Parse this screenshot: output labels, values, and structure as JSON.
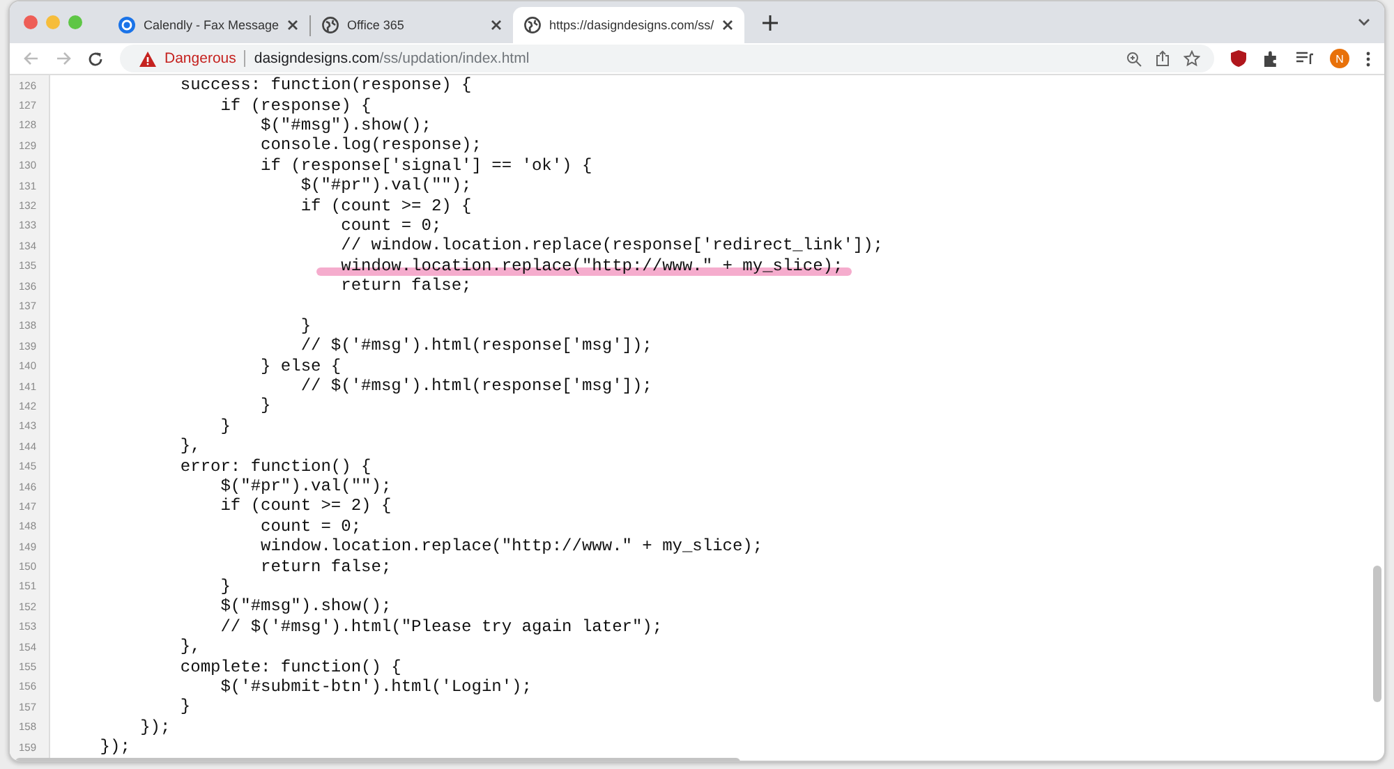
{
  "tabs": [
    {
      "title": "Calendly - Fax Message",
      "kind": "calendly",
      "selected": false
    },
    {
      "title": "Office 365",
      "kind": "web",
      "selected": false
    },
    {
      "title": "https://dasigndesigns.com/ss/",
      "kind": "web",
      "selected": true
    }
  ],
  "address_bar": {
    "security_label": "Dangerous",
    "domain": "dasigndesigns.com",
    "path": "/ss/updation/index.html"
  },
  "profile": {
    "initial": "N"
  },
  "source_lines": [
    {
      "number": "126",
      "code": "            success: function(response) {",
      "highlighted": false
    },
    {
      "number": "127",
      "code": "                if (response) {",
      "highlighted": false
    },
    {
      "number": "128",
      "code": "                    $(\"#msg\").show();",
      "highlighted": false
    },
    {
      "number": "129",
      "code": "                    console.log(response);",
      "highlighted": false
    },
    {
      "number": "130",
      "code": "                    if (response['signal'] == 'ok') {",
      "highlighted": false
    },
    {
      "number": "131",
      "code": "                        $(\"#pr\").val(\"\");",
      "highlighted": false
    },
    {
      "number": "132",
      "code": "                        if (count >= 2) {",
      "highlighted": false
    },
    {
      "number": "133",
      "code": "                            count = 0;",
      "highlighted": false
    },
    {
      "number": "134",
      "code": "                            // window.location.replace(response['redirect_link']);",
      "highlighted": false
    },
    {
      "number": "135",
      "code": "                            window.location.replace(\"http://www.\" + my_slice);",
      "highlighted": true
    },
    {
      "number": "136",
      "code": "                            return false;",
      "highlighted": false
    },
    {
      "number": "137",
      "highlighted": false
    },
    {
      "number": "138",
      "code": "                        }",
      "highlighted": false
    },
    {
      "number": "139",
      "code": "                        // $('#msg').html(response['msg']);",
      "highlighted": false
    },
    {
      "number": "140",
      "code": "                    } else {",
      "highlighted": false
    },
    {
      "number": "141",
      "code": "                        // $('#msg').html(response['msg']);",
      "highlighted": false
    },
    {
      "number": "142",
      "code": "                    }",
      "highlighted": false
    },
    {
      "number": "143",
      "code": "                }",
      "highlighted": false
    },
    {
      "number": "144",
      "code": "            },",
      "highlighted": false
    },
    {
      "number": "145",
      "code": "            error: function() {",
      "highlighted": false
    },
    {
      "number": "146",
      "code": "                $(\"#pr\").val(\"\");",
      "highlighted": false
    },
    {
      "number": "147",
      "code": "                if (count >= 2) {",
      "highlighted": false
    },
    {
      "number": "148",
      "code": "                    count = 0;",
      "highlighted": false
    },
    {
      "number": "149",
      "code": "                    window.location.replace(\"http://www.\" + my_slice);",
      "highlighted": false
    },
    {
      "number": "150",
      "code": "                    return false;",
      "highlighted": false
    },
    {
      "number": "151",
      "code": "                }",
      "highlighted": false
    },
    {
      "number": "152",
      "code": "                $(\"#msg\").show();",
      "highlighted": false
    },
    {
      "number": "153",
      "code": "                // $('#msg').html(\"Please try again later\");",
      "highlighted": false
    },
    {
      "number": "154",
      "code": "            },",
      "highlighted": false
    },
    {
      "number": "155",
      "code": "            complete: function() {",
      "highlighted": false
    },
    {
      "number": "156",
      "code": "                $('#submit-btn').html('Login');",
      "highlighted": false
    },
    {
      "number": "157",
      "code": "            }",
      "highlighted": false
    },
    {
      "number": "158",
      "code": "        });",
      "highlighted": false
    },
    {
      "number": "159",
      "code": "    });",
      "highlighted": false
    }
  ]
}
